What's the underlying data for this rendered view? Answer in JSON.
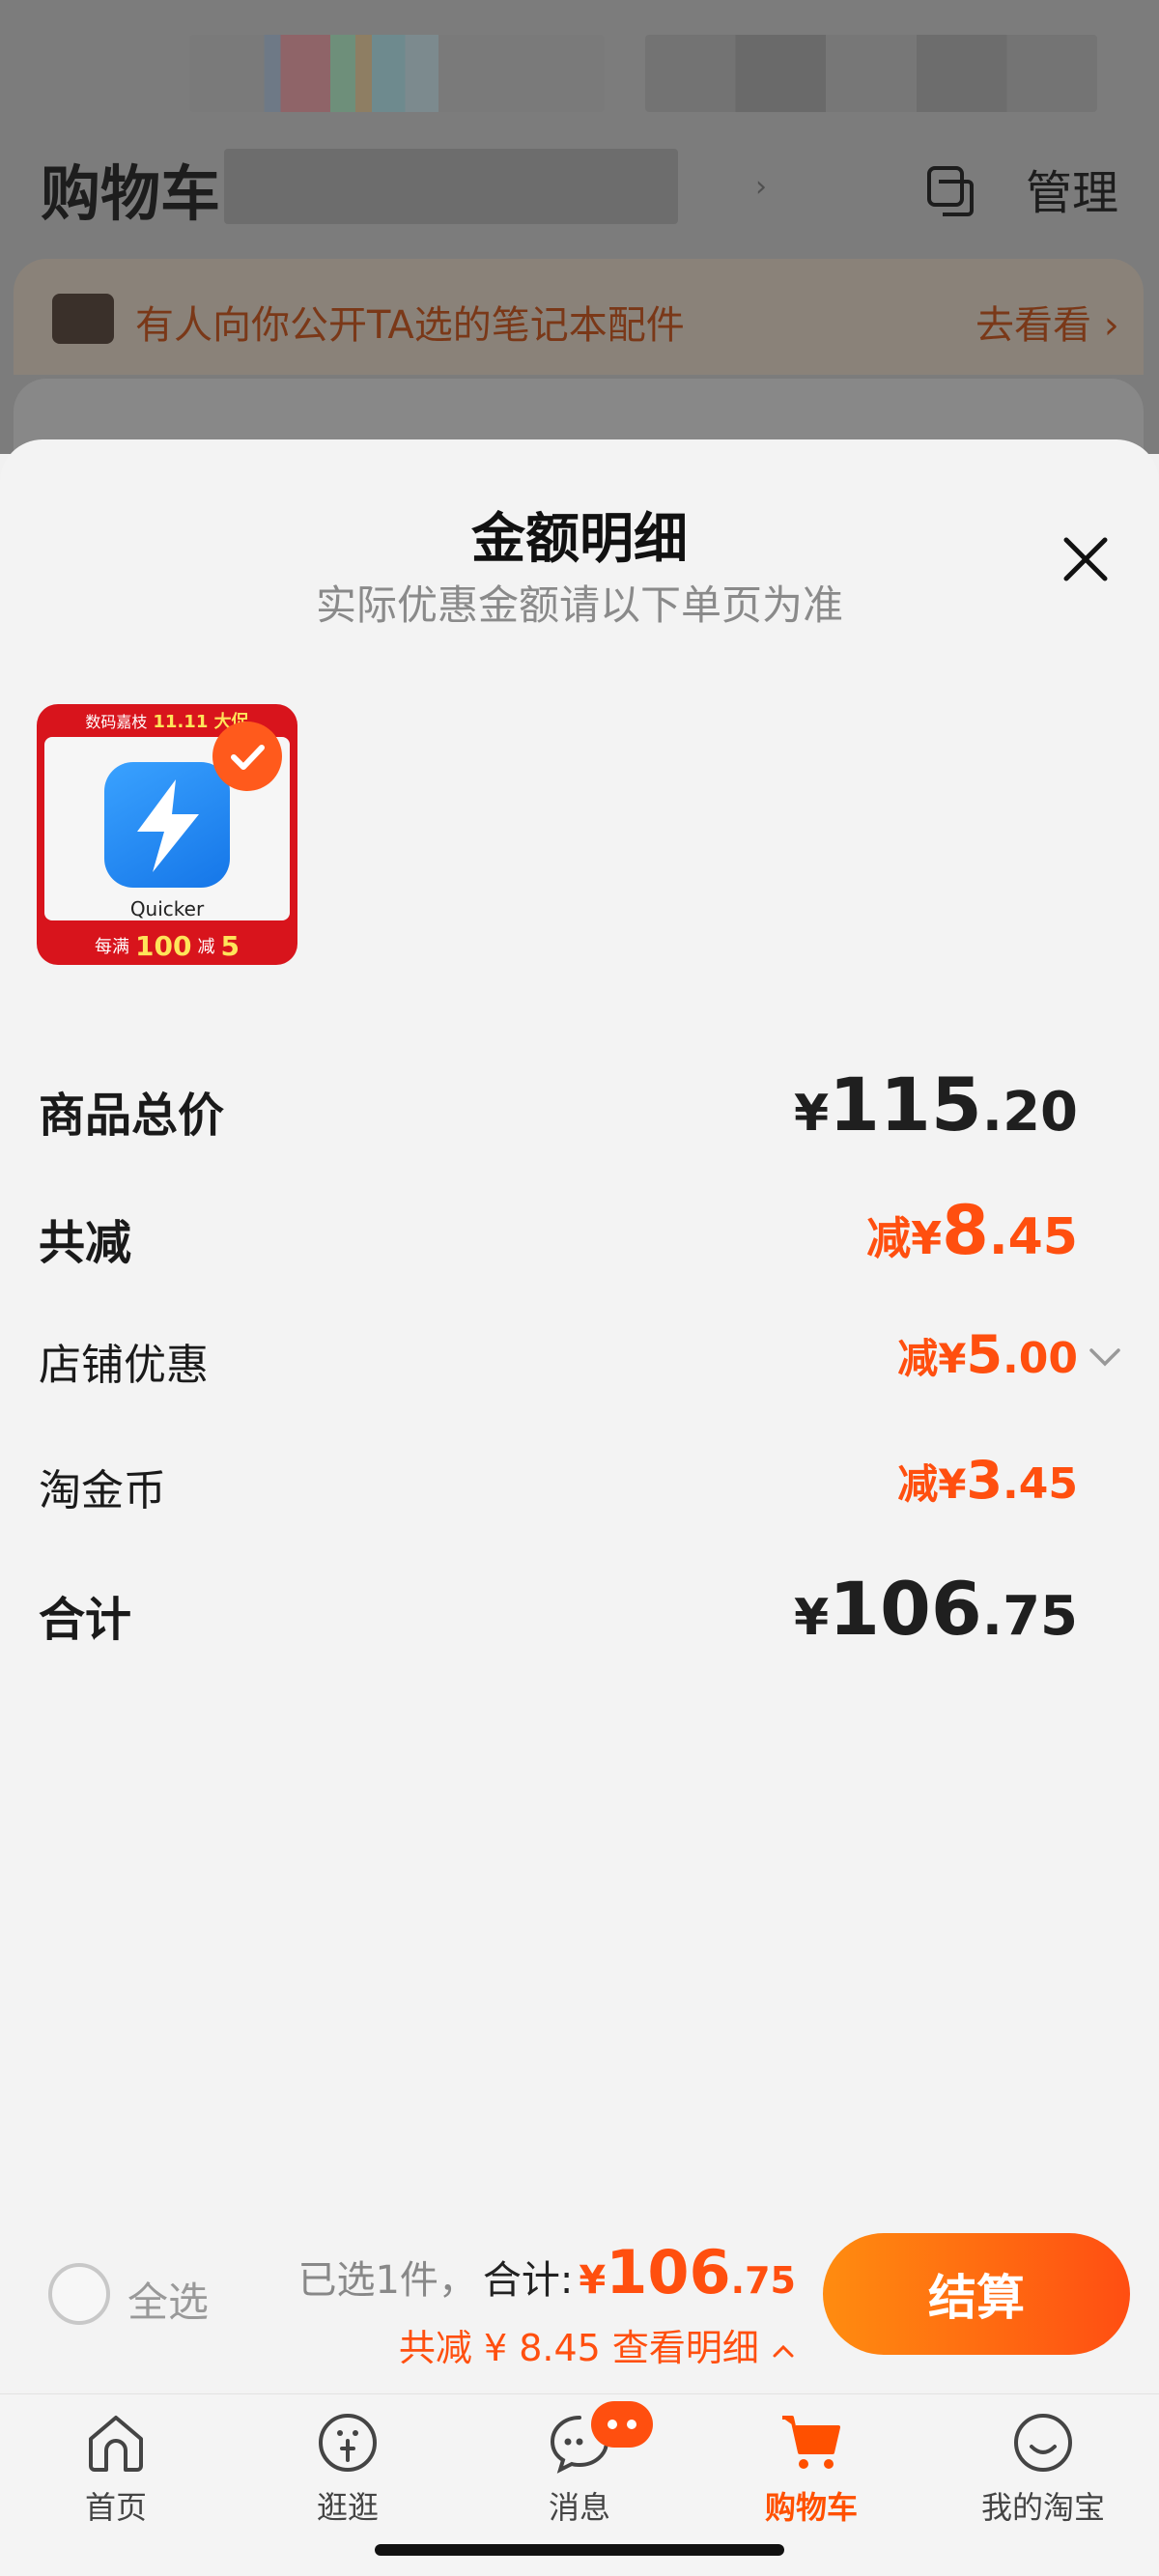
{
  "background": {
    "title": "购物车",
    "manage_label": "管理",
    "banner_text": "有人向你公开TA选的笔记本配件",
    "banner_link": "去看看"
  },
  "sheet": {
    "title": "金额明细",
    "subtitle": "实际优惠金额请以下单页为准",
    "product": {
      "promo_top": "数码嘉枝",
      "promo_top_event": "11.11 大促",
      "app_name": "Quicker",
      "promo_bottom_prefix": "每满",
      "promo_bottom_amount": "100",
      "promo_bottom_mid": "减",
      "promo_bottom_discount": "5",
      "selected": true
    },
    "rows": [
      {
        "label": "商品总价",
        "prefix": "",
        "currency": "¥",
        "int": "115",
        "dec": ".20"
      },
      {
        "label": "共减",
        "prefix": "减",
        "currency": "¥",
        "int": "8",
        "dec": ".45"
      },
      {
        "label": "店铺优惠",
        "prefix": "减",
        "currency": "¥",
        "int": "5",
        "dec": ".00"
      },
      {
        "label": "淘金币",
        "prefix": "减",
        "currency": "¥",
        "int": "3",
        "dec": ".45"
      },
      {
        "label": "合计",
        "prefix": "",
        "currency": "¥",
        "int": "106",
        "dec": ".75"
      }
    ]
  },
  "checkout": {
    "select_all_label": "全选",
    "selected_count": "已选1件，",
    "total_label": "合计:",
    "total_currency": "¥",
    "total_int": "106",
    "total_dec": ".75",
    "discount_text": "共减 ¥ 8.45  查看明细",
    "button_label": "结算"
  },
  "tabbar": {
    "tabs": [
      {
        "label": "首页",
        "icon": "home-icon"
      },
      {
        "label": "逛逛",
        "icon": "guangguang-icon"
      },
      {
        "label": "消息",
        "icon": "message-icon"
      },
      {
        "label": "购物车",
        "icon": "cart-icon",
        "active": true
      },
      {
        "label": "我的淘宝",
        "icon": "profile-icon"
      }
    ]
  },
  "colors": {
    "accent": "#ff5000",
    "price_orange": "#ff4f0f",
    "button_gradient_start": "#ff8c10",
    "button_gradient_end": "#ff4e12"
  }
}
